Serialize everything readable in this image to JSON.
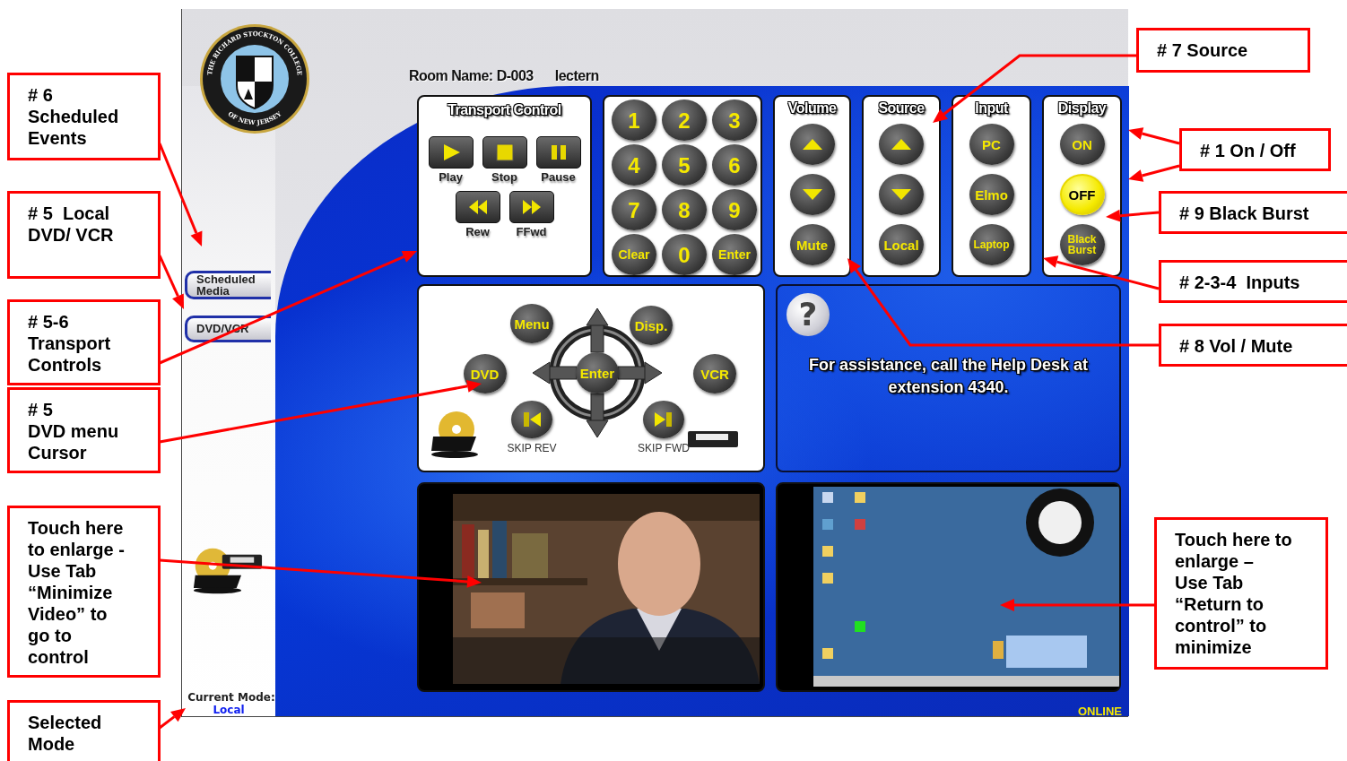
{
  "callouts": [
    {
      "text": "# 6\nScheduled\nEvents"
    },
    {
      "text": "# 5  Local\nDVD/ VCR"
    },
    {
      "text": "# 5-6\nTransport\nControls"
    },
    {
      "text": "# 5\nDVD menu\nCursor"
    },
    {
      "text": "Touch here\nto enlarge -\nUse Tab\n“Minimize\nVideo” to\ngo to\ncontrol"
    },
    {
      "text": "Selected\nMode"
    },
    {
      "text": "# 7 Source"
    },
    {
      "text": "# 1 On / Off"
    },
    {
      "text": "# 9 Black Burst"
    },
    {
      "text": "# 2-3-4  Inputs"
    },
    {
      "text": "# 8 Vol / Mute"
    },
    {
      "text": "Touch here to\nenlarge –\nUse Tab\n“Return to\ncontrol” to\nminimize"
    }
  ],
  "screen": {
    "logo": {
      "top_text": "THE RICHARD STOCKTON COLLEGE",
      "bottom_text": "OF NEW JERSEY"
    },
    "room_name": "Room Name: D-003",
    "room_location": "lectern",
    "sidebar": {
      "tabs": [
        {
          "label": "Scheduled Media"
        },
        {
          "label": "DVD/VCR"
        }
      ],
      "mode_label": "Current Mode:",
      "mode_value": "Local"
    },
    "transport": {
      "title": "Transport Control",
      "buttons": [
        {
          "kind": "play",
          "label": "Play"
        },
        {
          "kind": "stop",
          "label": "Stop"
        },
        {
          "kind": "pause",
          "label": "Pause"
        },
        {
          "kind": "rew",
          "label": "Rew"
        },
        {
          "kind": "ffwd",
          "label": "FFwd"
        }
      ]
    },
    "keypad": [
      "1",
      "2",
      "3",
      "4",
      "5",
      "6",
      "7",
      "8",
      "9",
      "Clear",
      "0",
      "Enter"
    ],
    "controls": [
      {
        "title": "Volume",
        "buttons": [
          {
            "kind": "up"
          },
          {
            "kind": "down"
          },
          {
            "kind": "text",
            "label": "Mute"
          }
        ]
      },
      {
        "title": "Source",
        "buttons": [
          {
            "kind": "up"
          },
          {
            "kind": "down"
          },
          {
            "kind": "text",
            "label": "Local"
          }
        ]
      },
      {
        "title": "Input",
        "buttons": [
          {
            "kind": "text",
            "label": "PC"
          },
          {
            "kind": "text",
            "label": "Elmo"
          },
          {
            "kind": "text",
            "label": "Laptop"
          }
        ]
      },
      {
        "title": "Display",
        "buttons": [
          {
            "kind": "text",
            "label": "ON",
            "selected": false
          },
          {
            "kind": "text",
            "label": "OFF",
            "selected": true
          },
          {
            "kind": "text",
            "label": "Black Burst",
            "selected": false
          }
        ]
      }
    ],
    "dvd_panel": {
      "menu": "Menu",
      "display": "Disp.",
      "dvd": "DVD",
      "vcr": "VCR",
      "enter": "Enter",
      "skip_rev": "SKIP REV",
      "skip_fwd": "SKIP FWD"
    },
    "help": {
      "icon": "?",
      "text": "For assistance, call the Help Desk at extension 4340."
    },
    "status": "ONLINE"
  }
}
